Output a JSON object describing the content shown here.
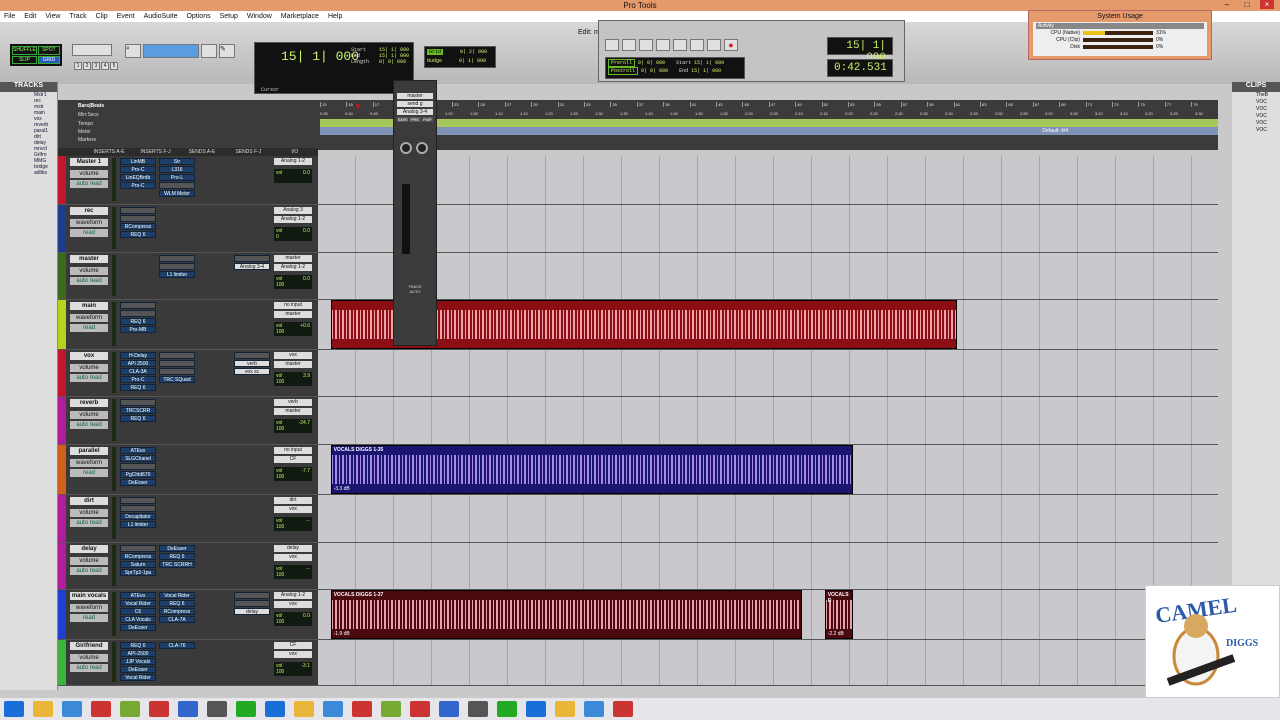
{
  "window": {
    "title": "Pro Tools",
    "edit_title": "Edit: m"
  },
  "menu": [
    "File",
    "Edit",
    "View",
    "Track",
    "Clip",
    "Event",
    "AudioSuite",
    "Options",
    "Setup",
    "Window",
    "Marketplace",
    "Help"
  ],
  "toolbar": {
    "modes": [
      "SHUFFLE",
      "SPOT",
      "SLIP",
      "GRID"
    ],
    "zoom_presets": [
      "1",
      "2",
      "3",
      "4",
      "5"
    ],
    "main_counter": "15| 1| 000",
    "cursor_label": "Cursor",
    "start_label": "Start",
    "end_label": "End",
    "length_label": "Length",
    "start": "15| 1| 000",
    "end": "15| 1| 000",
    "length": "0| 0| 000",
    "grid_label": "Grid",
    "grid_value": "0| 2| 000",
    "nudge_label": "Nudge",
    "nudge_value": "0| 1| 000"
  },
  "transport": {
    "preroll_label": "Preroll",
    "postroll_label": "Postroll",
    "preroll": "0| 0| 000",
    "postroll": "0| 0| 000",
    "start": "15| 1| 000",
    "end": "15| 1| 000",
    "length": "0| 0| 000",
    "bars": "15| 1| 000",
    "time": "0:42.531",
    "rec_color": "#d22"
  },
  "system_usage": {
    "title": "System Usage",
    "section": "Activity",
    "meters": [
      {
        "label": "CPU (Native)",
        "value": "31%",
        "fraction": 0.31
      },
      {
        "label": "CPU (Clip)",
        "value": "0%",
        "fraction": 0
      },
      {
        "label": "Disk",
        "value": "0%",
        "fraction": 0
      }
    ]
  },
  "tracks_panel": {
    "title": "TRACKS",
    "items": [
      "Mstr1",
      "rec",
      "mstr",
      "main",
      "vox",
      "reverb",
      "paral1",
      "dirt",
      "delay",
      "mnvcl",
      "Grlfrn",
      "MMG",
      "bridge",
      "adlibs"
    ]
  },
  "clips_panel": {
    "title": "CLIPS",
    "items": [
      "TheB",
      "VOC",
      "VOC",
      "VOC",
      "VOC",
      "VOC"
    ]
  },
  "rulers": {
    "bars_label": "Bars|Beats",
    "min_secs_label": "Min:Secs",
    "tempo_label": "Tempo",
    "meter_label": "Meter",
    "markers_label": "Markers",
    "meter_value": "Default: 4/4",
    "bars": [
      "13",
      "15",
      "17",
      "19",
      "21",
      "23",
      "25",
      "27",
      "29",
      "31",
      "33",
      "35",
      "37",
      "39",
      "41",
      "43",
      "45",
      "47",
      "49",
      "51",
      "53",
      "55",
      "57",
      "59",
      "61",
      "63",
      "65",
      "67",
      "69",
      "71",
      "73",
      "75",
      "77",
      "79"
    ],
    "secs": [
      "0:35",
      "0:40",
      "0:45",
      "0:50",
      "0:55",
      "1:00",
      "1:05",
      "1:10",
      "1:15",
      "1:20",
      "1:25",
      "1:30",
      "1:35",
      "1:40",
      "1:45",
      "1:50",
      "1:55",
      "2:00",
      "2:05",
      "2:10",
      "2:15",
      "2:20",
      "2:25",
      "2:30",
      "2:35",
      "2:40",
      "2:45",
      "2:50",
      "2:55",
      "3:00",
      "3:05",
      "3:10",
      "3:15",
      "3:20",
      "3:25",
      "3:30"
    ]
  },
  "mix_columns": [
    "INSERTS A-E",
    "INSERTS F-J",
    "SENDS A-E",
    "SENDS F-J",
    "I/O"
  ],
  "tracks": [
    {
      "name": "Master 1",
      "color": "#c0182a",
      "view": "volume",
      "mode": "auto read",
      "ins_a": [
        "LinMB",
        "Pro-C",
        "LinEQBrdb",
        "Pro-C"
      ],
      "ins_f": [
        "Str",
        "L316",
        "Pro-L",
        "",
        "WLM Meter"
      ],
      "sends": [],
      "io": [
        "Analog 1-2"
      ],
      "vol": "0.0",
      "pan": ""
    },
    {
      "name": "rec",
      "color": "#1d3c8c",
      "view": "waveform",
      "mode": "read",
      "ins_a": [
        "",
        "",
        "RCompress",
        "REQ 6"
      ],
      "ins_f": [],
      "sends": [],
      "io": [
        "Analog 3",
        "Analog 1-2"
      ],
      "vol": "0.0",
      "pan": "0"
    },
    {
      "name": "master",
      "color": "#3b6b1c",
      "view": "volume",
      "mode": "auto read",
      "ins_a": [],
      "ins_f": [
        "",
        "",
        "L1 limiter"
      ],
      "sends": [
        "",
        "Analog 3-4"
      ],
      "io": [
        "master",
        "Analog 1-2"
      ],
      "vol": "0.0",
      "pan": "100"
    },
    {
      "name": "main",
      "color": "#b6d21a",
      "view": "waveform",
      "mode": "read",
      "ins_a": [
        "",
        "",
        "REQ 6",
        "Pro-MB"
      ],
      "ins_f": [],
      "sends": [],
      "io": [
        "no input",
        "master"
      ],
      "vol": "+0.6",
      "pan": "100"
    },
    {
      "name": "vox",
      "color": "#c0182a",
      "view": "volume",
      "mode": "auto read",
      "ins_a": [
        "H-Delay",
        "API 2500",
        "CLA-3A",
        "Pro-C",
        "REQ 6"
      ],
      "ins_f": [
        "",
        "",
        "",
        "TRC SQuad"
      ],
      "sends": [
        "",
        "verb",
        "vox sc"
      ],
      "io": [
        "vox",
        "master"
      ],
      "vol": "3.9",
      "pan": "100"
    },
    {
      "name": "reverb",
      "color": "#b01c9a",
      "view": "volume",
      "mode": "auto read",
      "ins_a": [
        "",
        "TRCSCRR",
        "REQ 6"
      ],
      "ins_f": [],
      "sends": [],
      "io": [
        "verb",
        "master"
      ],
      "vol": "-24.7",
      "pan": "100"
    },
    {
      "name": "parallel",
      "color": "#d0601a",
      "view": "waveform",
      "mode": "read",
      "ins_a": [
        "ATEvo",
        "SLGChanel",
        "",
        "PgChld670",
        "DeEsser"
      ],
      "ins_f": [],
      "sends": [],
      "io": [
        "no input",
        "CF"
      ],
      "vol": "-7.7",
      "pan": "100"
    },
    {
      "name": "dirt",
      "color": "#b01c9a",
      "view": "volume",
      "mode": "auto read",
      "ins_a": [
        "",
        "",
        "Decapitator",
        "L1 limiter"
      ],
      "ins_f": [],
      "sends": [],
      "io": [
        "dirt",
        "vox"
      ],
      "vol": "--",
      "pan": "100"
    },
    {
      "name": "delay",
      "color": "#b01c9a",
      "view": "volume",
      "mode": "auto read",
      "ins_a": [
        "",
        "RCompress",
        "Saturn",
        "SprTp2-1pa"
      ],
      "ins_f": [
        "DeEsser",
        "REQ 6",
        "TRC SCRRH"
      ],
      "sends": [],
      "io": [
        "delay",
        "vox"
      ],
      "vol": "--",
      "pan": "100"
    },
    {
      "name": "main vocals",
      "color": "#1f3fcf",
      "view": "waveform",
      "mode": "read",
      "ins_a": [
        "ATEvo",
        "Vocal Rider",
        "C6",
        "CLA Vocals",
        "DeEsser"
      ],
      "ins_f": [
        "Vocal Rider",
        "REQ 6",
        "RCompress",
        "CLA-7A"
      ],
      "sends": [
        "",
        "",
        "delay"
      ],
      "io": [
        "Analog 1-2",
        "vox"
      ],
      "vol": "0.0",
      "pan": "100"
    },
    {
      "name": "Girlfriend",
      "color": "#3cb43c",
      "view": "volume",
      "mode": "auto read",
      "ins_a": [
        "REQ 6",
        "API-2500",
        "JJP Vocals",
        "DeEsser",
        "Vocal Rider"
      ],
      "ins_f": [
        "CLA-76"
      ],
      "sends": [],
      "io": [
        "CF",
        "vox"
      ],
      "vol": "-3.1",
      "pan": "100"
    }
  ],
  "clips": [
    {
      "track": 3,
      "label": "",
      "gain": "",
      "start_frac": 0.014,
      "end_frac": 0.71,
      "fill": "#8a0e14",
      "wave": "#f0a0a8"
    },
    {
      "track": 6,
      "label": "VOCALS DIGGS 1-35",
      "gain": "-3.3 dB",
      "start_frac": 0.014,
      "end_frac": 0.594,
      "fill": "#1a1670",
      "wave": "#a88ae8"
    },
    {
      "track": 9,
      "label": "VOCALS DIGGS 1-37",
      "gain": "-1.9 dB",
      "start_frac": 0.014,
      "end_frac": 0.538,
      "fill": "#4a0a10",
      "wave": "#e9a0aa"
    },
    {
      "track": 9,
      "label": "VOCALS D",
      "gain": "-2.2 dB",
      "start_frac": 0.563,
      "end_frac": 0.594,
      "fill": "#4a0a10",
      "wave": "#e9a0aa"
    }
  ],
  "minimix": {
    "name": "master",
    "send": "send g",
    "output": "Analog 3-4",
    "buttons": [
      "SAFE",
      "PRE",
      "FMP"
    ],
    "footer": [
      "TRACK",
      "AUTO"
    ]
  },
  "logo": {
    "text": "CAMEL DIGGS"
  }
}
